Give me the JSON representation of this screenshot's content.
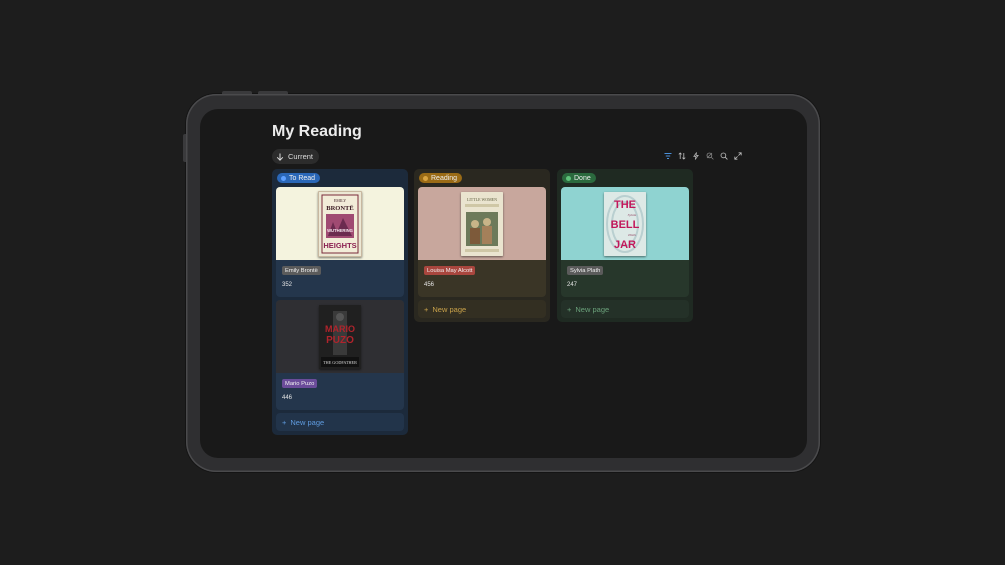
{
  "page": {
    "title": "My Reading"
  },
  "view": {
    "label": "Current",
    "icon": "arrow-down-icon"
  },
  "toolbar": {
    "icons": [
      "filter-icon",
      "sort-icon",
      "lightning-icon",
      "search-off-icon",
      "search-icon",
      "expand-icon"
    ]
  },
  "columns": [
    {
      "status": "To Read",
      "status_color": "#2a67b8",
      "cards": [
        {
          "author": "Emily Brontë",
          "pages": "352",
          "cover": "Wuthering Heights cover"
        },
        {
          "author": "Mario Puzo",
          "pages": "446",
          "cover": "The Godfather cover"
        }
      ],
      "new_page": "New page"
    },
    {
      "status": "Reading",
      "status_color": "#9a6b16",
      "cards": [
        {
          "author": "Louisa May Alcott",
          "pages": "456",
          "cover": "Little Women cover"
        }
      ],
      "new_page": "New page"
    },
    {
      "status": "Done",
      "status_color": "#2b6a3e",
      "cards": [
        {
          "author": "Sylvia Plath",
          "pages": "247",
          "cover": "The Bell Jar cover"
        }
      ],
      "new_page": "New page"
    }
  ],
  "covers": {
    "wuthering": {
      "l1": "EMILY",
      "l2": "BRONTË",
      "l3": "WUTHERING",
      "l4": "HEIGHTS"
    },
    "godfather": {
      "l1": "MARIO",
      "l2": "PUZO",
      "l3": "THE GODFATHER"
    },
    "littlewomen": {
      "l1": "LITTLE WOMEN"
    },
    "belljar": {
      "l1": "THE",
      "l2": "BELL",
      "l3": "JAR",
      "l4": "Sylvia",
      "l5": "Plath"
    }
  }
}
